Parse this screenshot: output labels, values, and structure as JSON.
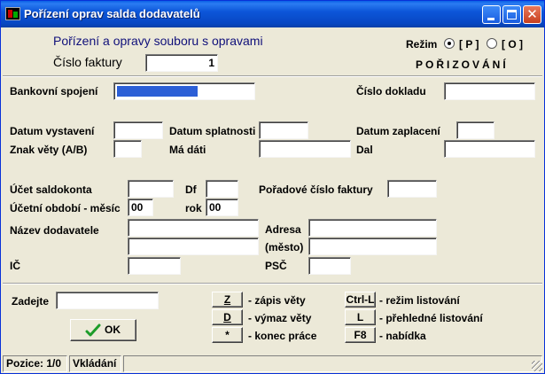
{
  "window": {
    "title": "Pořízení oprav salda dodavatelů"
  },
  "header": {
    "subtitle": "Pořízení a opravy souboru s opravami",
    "invoice_label": "Číslo faktury",
    "invoice_value": "1",
    "mode_label": "Režim",
    "mode_p": "[ P ]",
    "mode_o": "[ O ]",
    "mode_selected": "P",
    "mode_status": "POŘIZOVÁNÍ"
  },
  "form": {
    "bank_label": "Bankovní spojení",
    "bank_fill_percent": 60,
    "doc_number_label": "Číslo dokladu",
    "doc_number_value": "",
    "issue_date_label": "Datum vystavení",
    "due_date_label": "Datum splatnosti",
    "paid_date_label": "Datum zaplacení",
    "sign_label": "Znak věty (A/B)",
    "debit_label": "Má dáti",
    "credit_label": "Dal",
    "account_label": "Účet saldokonta",
    "df_label": "Df",
    "order_number_label": "Pořadové číslo faktury",
    "period_label": "Účetní období - měsíc",
    "period_month_value": "00",
    "year_label": "rok",
    "year_value": "00",
    "supplier_name_label": "Název dodavatele",
    "address_label": "Adresa",
    "city_label": "(město)",
    "ic_label": "IČ",
    "psc_label": "PSČ"
  },
  "controls": {
    "enter_label": "Zadejte",
    "enter_value": "",
    "ok_label": "OK",
    "keys": [
      {
        "key": "Z",
        "desc": "- zápis věty"
      },
      {
        "key": "D",
        "desc": "- výmaz věty"
      },
      {
        "key": "*",
        "desc": "- konec práce"
      }
    ],
    "keys_right": [
      {
        "key": "Ctrl-L",
        "desc": "- režim listování"
      },
      {
        "key": "L",
        "desc": "- přehledné listování"
      },
      {
        "key": "F8",
        "desc": "- nabídka"
      }
    ]
  },
  "status": {
    "position": "Pozice: 1/0",
    "mode": "Vkládání"
  },
  "colors": {
    "title_bar": "#0c56d9",
    "window_bg": "#ece9d8",
    "progress": "#2c5fd6",
    "ok_check": "#1c9c2a"
  }
}
